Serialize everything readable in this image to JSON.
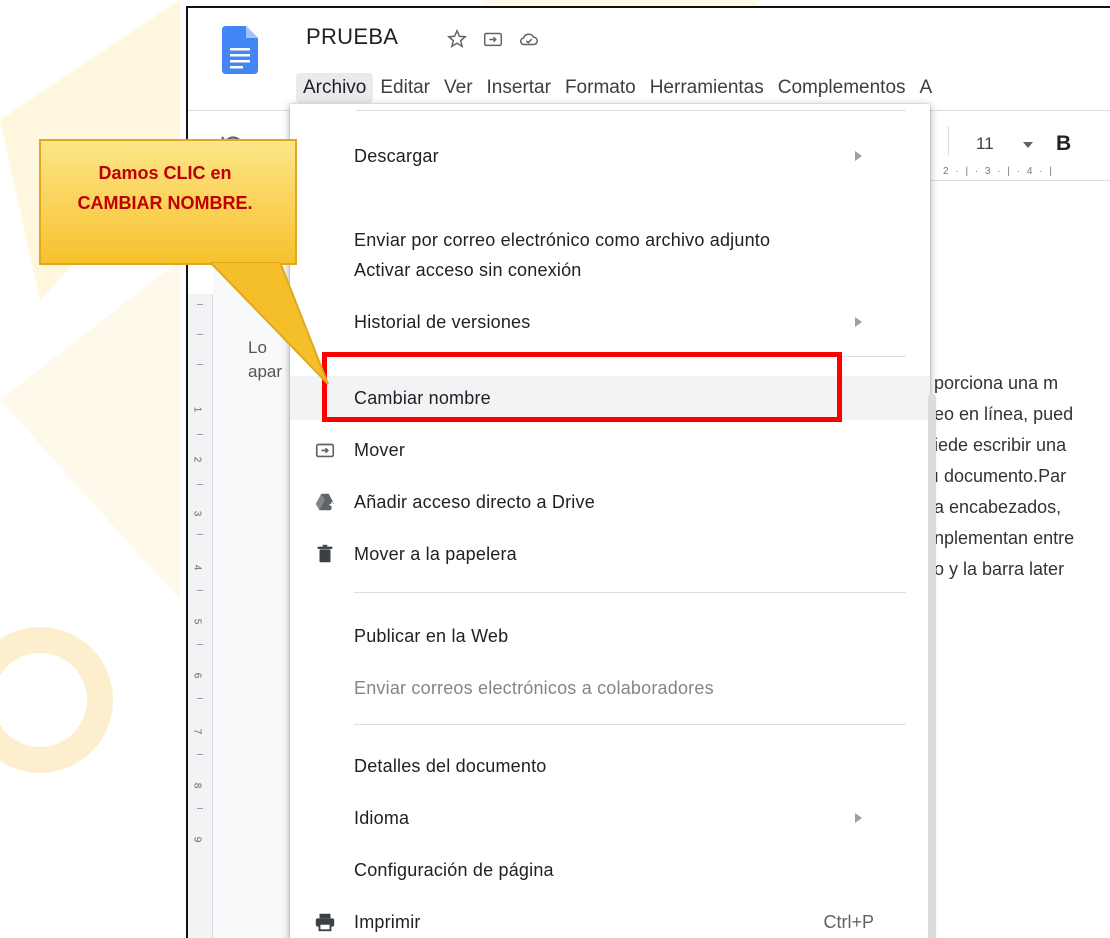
{
  "document": {
    "title": "PRUEBA",
    "font_size": "11",
    "bold_label": "B",
    "ruler_text": "2 · | · 3 · | · 4 · |",
    "vertical_ruler_marks": [
      "1",
      "2",
      "3",
      "4",
      "5",
      "6",
      "7",
      "8",
      "9"
    ],
    "left_text_lines": [
      "Lo",
      "apar"
    ],
    "body_lines": [
      "porciona una m",
      "eo en línea, pued",
      "iede escribir una",
      "ı documento.Par",
      "a encabezados, ",
      "nplementan entre",
      "o y la barra later"
    ]
  },
  "menubar": {
    "items": [
      "Archivo",
      "Editar",
      "Ver",
      "Insertar",
      "Formato",
      "Herramientas",
      "Complementos",
      "A"
    ],
    "active_index": 0
  },
  "file_menu": {
    "items": [
      {
        "label": "Descargar",
        "submenu": true,
        "icon": ""
      },
      {
        "label": "Enviar por correo electrónico como archivo adjunto",
        "icon": ""
      },
      {
        "label": "Activar acceso sin conexión",
        "icon": ""
      },
      {
        "label": "Historial de versiones",
        "submenu": true,
        "icon": ""
      },
      {
        "label": "Cambiar nombre",
        "highlighted": true,
        "icon": ""
      },
      {
        "label": "Mover",
        "icon": "move-folder-icon"
      },
      {
        "label": "Añadir acceso directo a Drive",
        "icon": "drive-shortcut-icon"
      },
      {
        "label": "Mover a la papelera",
        "icon": "trash-icon"
      },
      {
        "label": "Publicar en la Web",
        "icon": ""
      },
      {
        "label": "Enviar correos electrónicos a colaboradores",
        "disabled": true,
        "icon": ""
      },
      {
        "label": "Detalles del documento",
        "icon": ""
      },
      {
        "label": "Idioma",
        "submenu": true,
        "icon": ""
      },
      {
        "label": "Configuración de página",
        "icon": ""
      },
      {
        "label": "Imprimir",
        "shortcut": "Ctrl+P",
        "icon": "print-icon"
      }
    ]
  },
  "annotation": {
    "line1": "Damos CLIC en",
    "line2": "CAMBIAR NOMBRE.",
    "text_color": "#c00000",
    "callout_fill": "#fcd34d",
    "highlight_color": "#ff0000"
  },
  "colors": {
    "docs_blue": "#4285f4",
    "menu_hover": "#f1f3f4",
    "divider": "#dadce0"
  }
}
